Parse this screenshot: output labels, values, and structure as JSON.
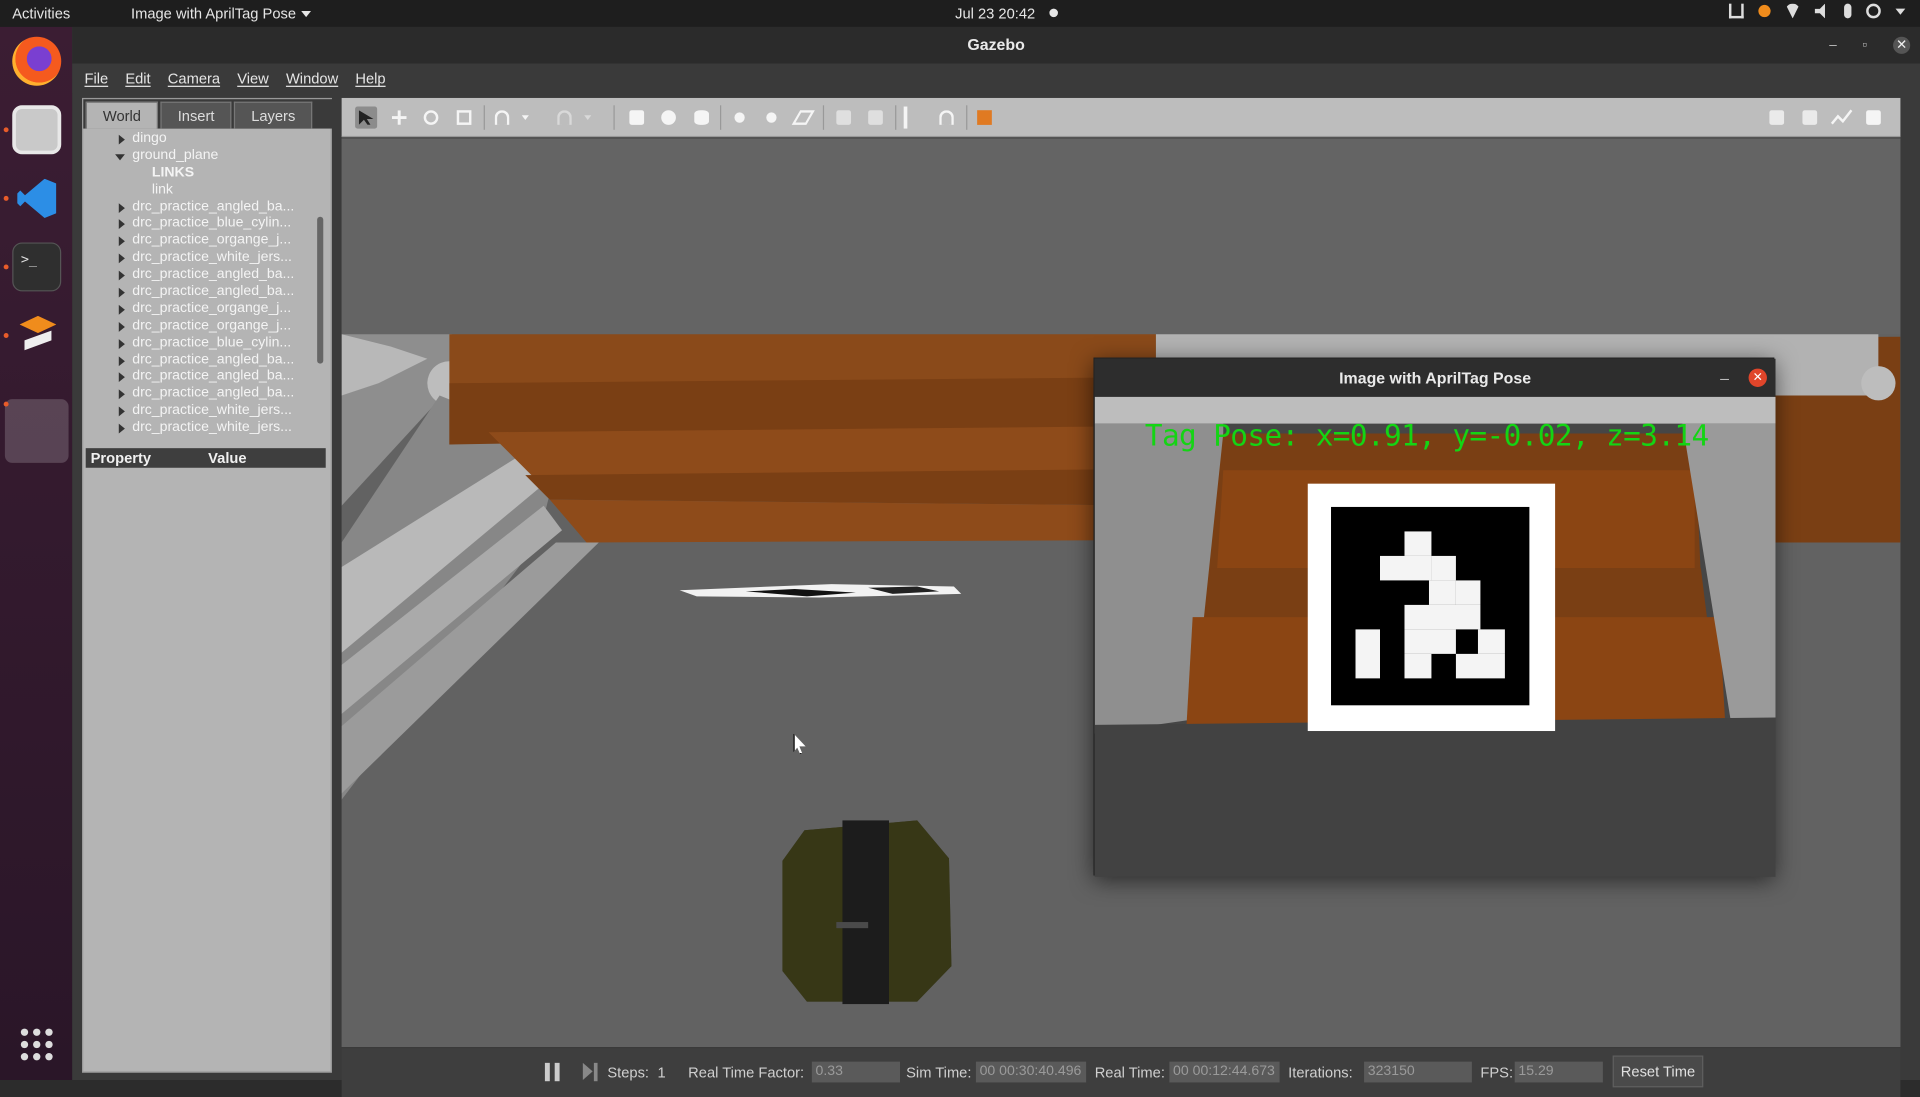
{
  "topbar": {
    "activities": "Activities",
    "app_menu": "Image with AprilTag Pose",
    "clock": "Jul 23  20:42"
  },
  "dock": {
    "apps": [
      "firefox-icon",
      "files-icon",
      "vscode-icon",
      "terminal-icon",
      "sublime-text-icon"
    ],
    "terminal_glyph": ">_"
  },
  "gazebo": {
    "title": "Gazebo",
    "window_controls": {
      "minimize": "–",
      "maximize": "▫",
      "close": "✕"
    },
    "menu": [
      "File",
      "Edit",
      "Camera",
      "View",
      "Window",
      "Help"
    ],
    "left_tabs": [
      "World",
      "Insert",
      "Layers"
    ],
    "tree": [
      {
        "label": "dingo",
        "level": 0,
        "expand": "collapsed"
      },
      {
        "label": "ground_plane",
        "level": 0,
        "expand": "expanded"
      },
      {
        "label": "LINKS",
        "level": 1,
        "bold": true
      },
      {
        "label": "link",
        "level": 1
      },
      {
        "label": "drc_practice_angled_ba...",
        "level": 0,
        "expand": "collapsed"
      },
      {
        "label": "drc_practice_blue_cylin...",
        "level": 0,
        "expand": "collapsed"
      },
      {
        "label": "drc_practice_organge_j...",
        "level": 0,
        "expand": "collapsed"
      },
      {
        "label": "drc_practice_white_jers...",
        "level": 0,
        "expand": "collapsed"
      },
      {
        "label": "drc_practice_angled_ba...",
        "level": 0,
        "expand": "collapsed"
      },
      {
        "label": "drc_practice_angled_ba...",
        "level": 0,
        "expand": "collapsed"
      },
      {
        "label": "drc_practice_organge_j...",
        "level": 0,
        "expand": "collapsed"
      },
      {
        "label": "drc_practice_organge_j...",
        "level": 0,
        "expand": "collapsed"
      },
      {
        "label": "drc_practice_blue_cylin...",
        "level": 0,
        "expand": "collapsed"
      },
      {
        "label": "drc_practice_angled_ba...",
        "level": 0,
        "expand": "collapsed"
      },
      {
        "label": "drc_practice_angled_ba...",
        "level": 0,
        "expand": "collapsed"
      },
      {
        "label": "drc_practice_angled_ba...",
        "level": 0,
        "expand": "collapsed"
      },
      {
        "label": "drc_practice_white_jers...",
        "level": 0,
        "expand": "collapsed"
      },
      {
        "label": "drc_practice_white_jers...",
        "level": 0,
        "expand": "collapsed"
      }
    ],
    "property_header": {
      "property": "Property",
      "value": "Value"
    },
    "toolbar": {
      "left_tools": [
        "select-arrow-icon",
        "translate-icon",
        "rotate-icon",
        "scale-icon",
        "undo-icon",
        "undo-history-dropdown-icon",
        "redo-icon",
        "redo-history-dropdown-icon",
        "box-icon",
        "sphere-icon",
        "cylinder-icon",
        "point-light-icon",
        "spot-light-icon",
        "directional-light-icon",
        "copy-icon",
        "paste-icon",
        "align-icon",
        "magnet-icon",
        "view-angle-icon"
      ],
      "right_tools": [
        "screenshot-icon",
        "log-icon",
        "plot-icon",
        "video-record-icon"
      ]
    },
    "statusbar": {
      "steps_label": "Steps:",
      "steps_value": "1",
      "rtf_label": "Real Time Factor:",
      "rtf_value": "0.33",
      "sim_time_label": "Sim Time:",
      "sim_time_value": "00 00:30:40.496",
      "real_time_label": "Real Time:",
      "real_time_value": "00 00:12:44.673",
      "iterations_label": "Iterations:",
      "iterations_value": "323150",
      "fps_label": "FPS:",
      "fps_value": "15.29",
      "reset_label": "Reset Time"
    }
  },
  "image_window": {
    "title": "Image with AprilTag Pose",
    "minimize": "–",
    "close": "✕",
    "pose_text": "Tag Pose: x=0.91, y=-0.02, z=3.14"
  },
  "colors": {
    "pose_text": "#14d414",
    "barrier_orange": "#8b4513",
    "close_button": "#e0452a",
    "dock_accent": "#e85c2a"
  }
}
